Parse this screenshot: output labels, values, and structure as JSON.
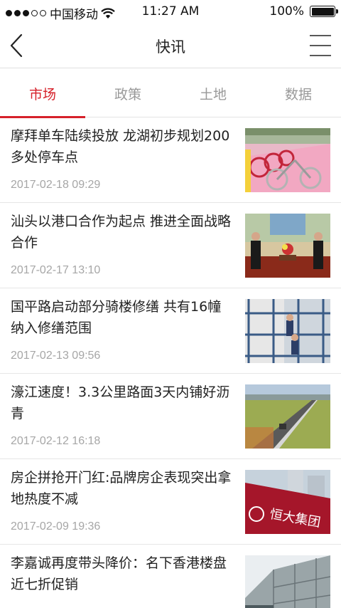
{
  "status_bar": {
    "carrier": "中国移动",
    "time": "11:27 AM",
    "battery": "100%",
    "battery_level": 1.0,
    "signal_bars_filled": 3,
    "signal_bars_total": 5
  },
  "nav": {
    "title": "快讯",
    "back_icon": "chevron-left-icon",
    "menu_icon": "hamburger-menu-icon"
  },
  "tabs": [
    {
      "label": "市场",
      "active": true
    },
    {
      "label": "政策",
      "active": false
    },
    {
      "label": "土地",
      "active": false
    },
    {
      "label": "数据",
      "active": false
    }
  ],
  "colors": {
    "accent": "#d6212a",
    "tab_inactive": "#999999",
    "date_text": "#a6a6a6"
  },
  "news": [
    {
      "title": "摩拜单车陆续投放 龙湖初步规划200多处停车点",
      "date": "2017-02-18 09:29"
    },
    {
      "title": "汕头以港口合作为起点 推进全面战略合作",
      "date": "2017-02-17 13:10"
    },
    {
      "title": "国平路启动部分骑楼修缮 共有16幢纳入修缮范围",
      "date": "2017-02-13 09:56"
    },
    {
      "title": "濠江速度！3.3公里路面3天内铺好沥青",
      "date": "2017-02-12 16:18"
    },
    {
      "title": "房企拼抢开门红:品牌房企表现突出拿地热度不减",
      "date": "2017-02-09 19:36"
    },
    {
      "title": "李嘉诚再度带头降价：名下香港楼盘近七折促销",
      "date": ""
    }
  ],
  "thumb_logo_text": "恒大集团"
}
